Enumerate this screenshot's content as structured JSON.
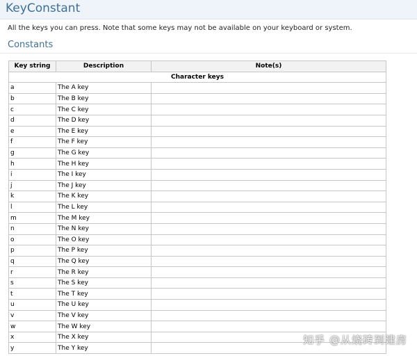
{
  "page": {
    "title": "KeyConstant",
    "intro": "All the keys you can press. Note that some keys may not be available on your keyboard or system.",
    "section": "Constants"
  },
  "table": {
    "headers": [
      "Key string",
      "Description",
      "Note(s)"
    ],
    "group": "Character keys",
    "rows": [
      [
        "a",
        "The A key",
        ""
      ],
      [
        "b",
        "The B key",
        ""
      ],
      [
        "c",
        "The C key",
        ""
      ],
      [
        "d",
        "The D key",
        ""
      ],
      [
        "e",
        "The E key",
        ""
      ],
      [
        "f",
        "The F key",
        ""
      ],
      [
        "g",
        "The G key",
        ""
      ],
      [
        "h",
        "The H key",
        ""
      ],
      [
        "i",
        "The I key",
        ""
      ],
      [
        "j",
        "The J key",
        ""
      ],
      [
        "k",
        "The K key",
        ""
      ],
      [
        "l",
        "The L key",
        ""
      ],
      [
        "m",
        "The M key",
        ""
      ],
      [
        "n",
        "The N key",
        ""
      ],
      [
        "o",
        "The O key",
        ""
      ],
      [
        "p",
        "The P key",
        ""
      ],
      [
        "q",
        "The Q key",
        ""
      ],
      [
        "r",
        "The R key",
        ""
      ],
      [
        "s",
        "The S key",
        ""
      ],
      [
        "t",
        "The T key",
        ""
      ],
      [
        "u",
        "The U key",
        ""
      ],
      [
        "v",
        "The V key",
        ""
      ],
      [
        "w",
        "The W key",
        ""
      ],
      [
        "x",
        "The X key",
        ""
      ],
      [
        "y",
        "The Y key",
        ""
      ]
    ]
  },
  "watermark": "知乎 @从烧砖到建房"
}
